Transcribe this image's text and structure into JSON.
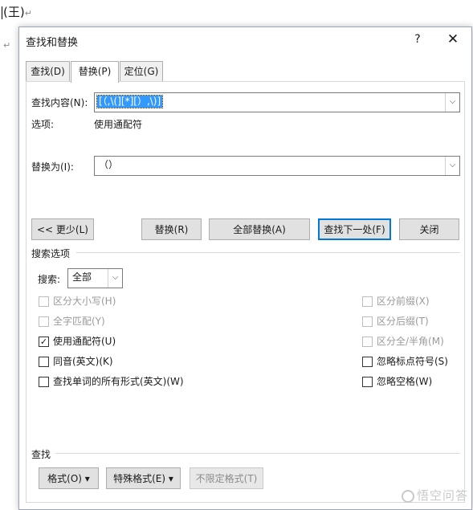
{
  "document": {
    "text": "(王)",
    "para_mark": "↵"
  },
  "dialog": {
    "title": "查找和替换",
    "help": "?",
    "close": "✕",
    "tabs": [
      {
        "label": "查找(D)",
        "active": false
      },
      {
        "label": "替换(P)",
        "active": true
      },
      {
        "label": "定位(G)",
        "active": false
      }
    ],
    "find": {
      "label": "查找内容(N):",
      "value": "[（,\\(][*][）,\\)]",
      "options_label": "选项:",
      "options_value": "使用通配符"
    },
    "replace": {
      "label": "替换为(I):",
      "value": "（）"
    },
    "buttons": {
      "less": "<< 更少(L)",
      "replace": "替换(R)",
      "replace_all": "全部替换(A)",
      "find_next": "查找下一处(F)",
      "close": "关闭"
    },
    "search_options": {
      "group_label": "搜索选项",
      "search_label": "搜索:",
      "search_value": "全部",
      "left": [
        {
          "label": "区分大小写(H)",
          "checked": false,
          "enabled": false
        },
        {
          "label": "全字匹配(Y)",
          "checked": false,
          "enabled": false
        },
        {
          "label": "使用通配符(U)",
          "checked": true,
          "enabled": true
        },
        {
          "label": "同音(英文)(K)",
          "checked": false,
          "enabled": true
        },
        {
          "label": "查找单词的所有形式(英文)(W)",
          "checked": false,
          "enabled": true
        }
      ],
      "right": [
        {
          "label": "区分前缀(X)",
          "checked": false,
          "enabled": false
        },
        {
          "label": "区分后缀(T)",
          "checked": false,
          "enabled": false
        },
        {
          "label": "区分全/半角(M)",
          "checked": false,
          "enabled": false
        },
        {
          "label": "忽略标点符号(S)",
          "checked": false,
          "enabled": true
        },
        {
          "label": "忽略空格(W)",
          "checked": false,
          "enabled": true
        }
      ]
    },
    "find_group": {
      "label": "查找",
      "format": "格式(O) ▾",
      "special": "特殊格式(E) ▾",
      "no_format": "不限定格式(T)"
    }
  },
  "watermark": "悟空问答"
}
